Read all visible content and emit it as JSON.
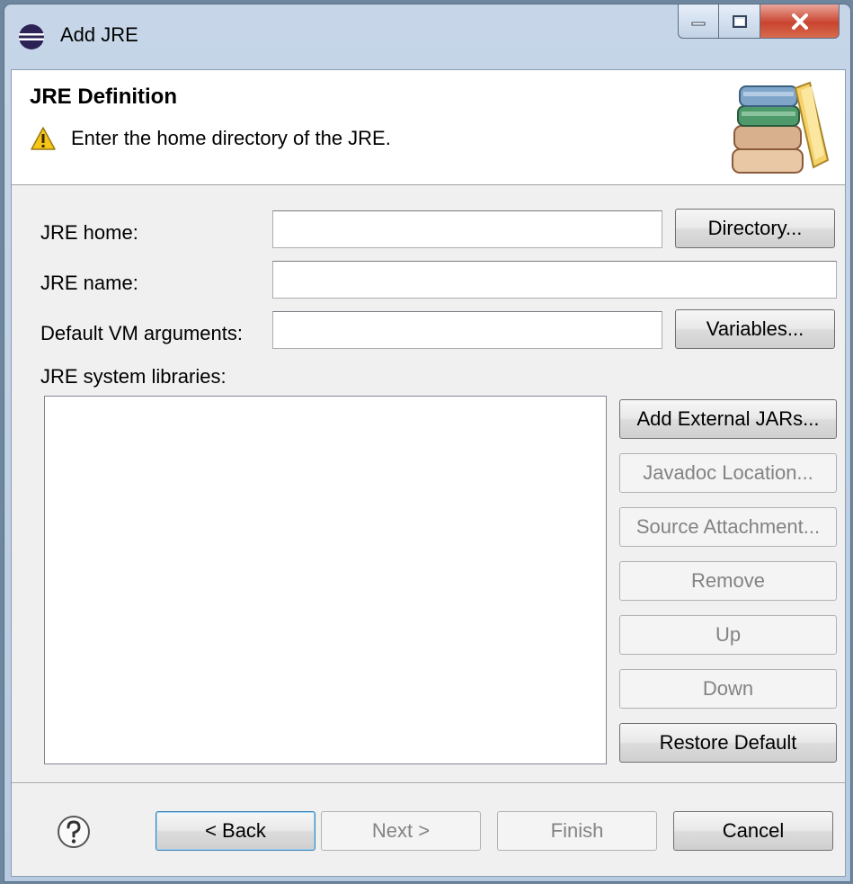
{
  "window": {
    "title": "Add JRE",
    "icon": "eclipse-icon"
  },
  "banner": {
    "title": "JRE Definition",
    "message": "Enter the home directory of the JRE.",
    "warning_icon": "warning-icon",
    "image_icon": "jre-books-icon"
  },
  "form": {
    "jre_home_label": "JRE home:",
    "jre_home_value": "",
    "jre_name_label": "JRE name:",
    "jre_name_value": "",
    "vm_args_label": "Default VM arguments:",
    "vm_args_value": "",
    "libraries_label": "JRE system libraries:",
    "libraries": []
  },
  "buttons": {
    "directory": "Directory...",
    "variables": "Variables...",
    "add_external_jars": "Add External JARs...",
    "javadoc_location": "Javadoc Location...",
    "source_attachment": "Source Attachment...",
    "remove": "Remove",
    "up": "Up",
    "down": "Down",
    "restore_default": "Restore Default"
  },
  "footer": {
    "back": "< Back",
    "next": "Next >",
    "finish": "Finish",
    "cancel": "Cancel",
    "help_icon": "help-icon"
  },
  "colors": {
    "accent": "#3c7fb1",
    "close": "#c9442f",
    "warning": "#f5c518"
  }
}
